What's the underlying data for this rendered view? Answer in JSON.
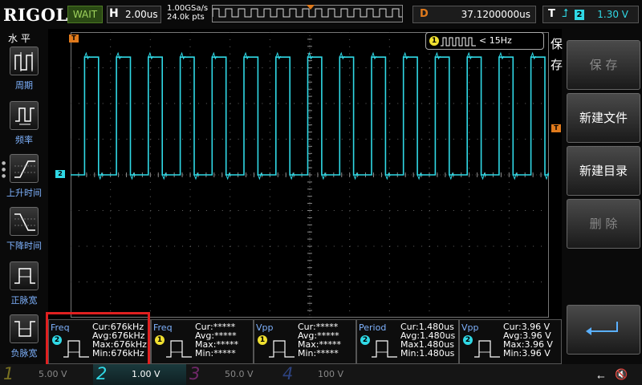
{
  "topbar": {
    "logo": "RIGOL",
    "run_state": "WAIT",
    "horizontal": {
      "key": "H",
      "value": "2.00us"
    },
    "sample_rate": "1.00GSa/s",
    "memory_depth": "24.0k pts",
    "delay": {
      "key": "D",
      "value": "37.1200000us"
    },
    "trigger": {
      "key": "T",
      "edge_icon": "rising-edge",
      "channel": "2",
      "level": "1.30 V"
    }
  },
  "left_panel": {
    "title": "水 平",
    "buttons": [
      {
        "label": "周期",
        "icon": "period-icon"
      },
      {
        "label": "频率",
        "icon": "frequency-icon"
      },
      {
        "label": "上升时间",
        "icon": "rise-time-icon"
      },
      {
        "label": "下降时间",
        "icon": "fall-time-icon"
      },
      {
        "label": "正脉宽",
        "icon": "positive-width-icon"
      },
      {
        "label": "负脉宽",
        "icon": "negative-width-icon"
      }
    ]
  },
  "screen": {
    "trigger_marker": "T",
    "channel_marker": "2",
    "ch1_freq_label": "< 15Hz",
    "ch1_badge": "1",
    "waveform": {
      "channel": "2",
      "color": "#30d9e6",
      "rising_edges_divs": [
        0.35,
        1.15,
        1.95,
        2.75,
        3.55,
        4.35,
        5.15,
        5.95,
        6.75,
        7.55,
        8.35,
        9.15,
        9.95,
        10.75,
        11.55
      ],
      "falling_edges_divs": [
        0.7,
        1.5,
        2.3,
        3.1,
        3.9,
        4.7,
        5.5,
        6.3,
        7.1,
        7.9,
        8.7,
        9.5,
        10.3,
        11.1,
        11.9
      ],
      "high_level_divs": 3.3,
      "low_level_divs": 0
    }
  },
  "right_panel": {
    "title": "保存",
    "buttons": [
      {
        "label": "保 存",
        "enabled": false
      },
      {
        "label": "新建文件",
        "enabled": true
      },
      {
        "label": "新建目录",
        "enabled": true
      },
      {
        "label": "删 除",
        "enabled": false
      }
    ],
    "return_icon": "return-arrow-icon"
  },
  "measurements": [
    {
      "name": "Freq",
      "channel": "2",
      "color": "#30d9e6",
      "cur": "Cur:676kHz",
      "avg": "Avg:676kHz",
      "max": "Max:676kHz",
      "min": "Min:676kHz"
    },
    {
      "name": "Freq",
      "channel": "1",
      "color": "#f0e030",
      "cur": "Cur:*****",
      "avg": "Avg:*****",
      "max": "Max:*****",
      "min": "Min:*****"
    },
    {
      "name": "Vpp",
      "channel": "1",
      "color": "#f0e030",
      "cur": "Cur:*****",
      "avg": "Avg:*****",
      "max": "Max:*****",
      "min": "Min:*****"
    },
    {
      "name": "Period",
      "channel": "2",
      "color": "#30d9e6",
      "cur": "Cur:1.480us",
      "avg": "Avg:1.480us",
      "max": "Max1.480us",
      "min": "Min:1.480us"
    },
    {
      "name": "Vpp",
      "channel": "2",
      "color": "#30d9e6",
      "cur": "Cur:3.96 V",
      "avg": "Avg:3.96 V",
      "max": "Max:3.96 V",
      "min": "Min:3.96 V"
    }
  ],
  "channels": [
    {
      "num": "1",
      "scale": "5.00 V",
      "color": "#f0e030"
    },
    {
      "num": "2",
      "scale": "1.00 V",
      "color": "#30d9e6"
    },
    {
      "num": "3",
      "scale": "50.0 V",
      "color": "#e040d0"
    },
    {
      "num": "4",
      "scale": "100 V",
      "color": "#4a7aff"
    }
  ],
  "status_icons": [
    "usb-icon",
    "speaker-mute-icon"
  ]
}
